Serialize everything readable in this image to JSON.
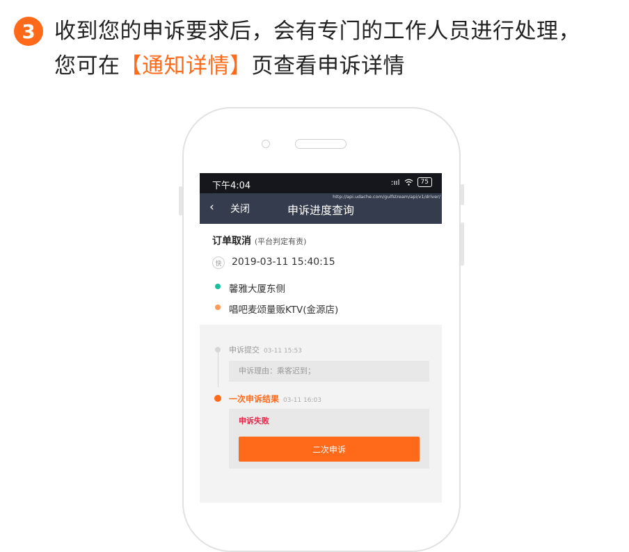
{
  "step": {
    "number": "3"
  },
  "instruction": {
    "line1": "收到您的申诉要求后，会有专门的工作人员进行处理，",
    "line2_prefix": "您可在",
    "line2_highlight": "【通知详情】",
    "line2_suffix": "页查看申诉详情"
  },
  "status_bar": {
    "time": "下午4:04",
    "signal": ":ııl",
    "wifi": "wifi-icon",
    "battery": "75"
  },
  "nav": {
    "url": "http://api.udache.com/gulfstream/api/v1/driver/",
    "back_icon": "‹",
    "close_label": "关闭",
    "title": "申诉进度查询"
  },
  "order_card": {
    "title": "订单取消",
    "subtitle": "(平台判定有责)",
    "badge": "快",
    "datetime": "2019-03-11 15:40:15",
    "from": "馨雅大厦东侧",
    "to": "唱吧麦颂量贩KTV(金源店)",
    "from_color": "#19c29a",
    "to_color": "#ff9b57"
  },
  "timeline": {
    "event1_label": "申诉提交",
    "event1_time": "03-11 15:53",
    "reason_text": "申诉理由：乘客迟到；",
    "event2_label": "一次申诉结果",
    "event2_time": "03-11 16:03",
    "result_text": "申诉失败",
    "button_label": "二次申诉"
  },
  "colors": {
    "accent": "#ff6a1a",
    "nav_bg": "#343c4d",
    "fail": "#e0294b"
  }
}
